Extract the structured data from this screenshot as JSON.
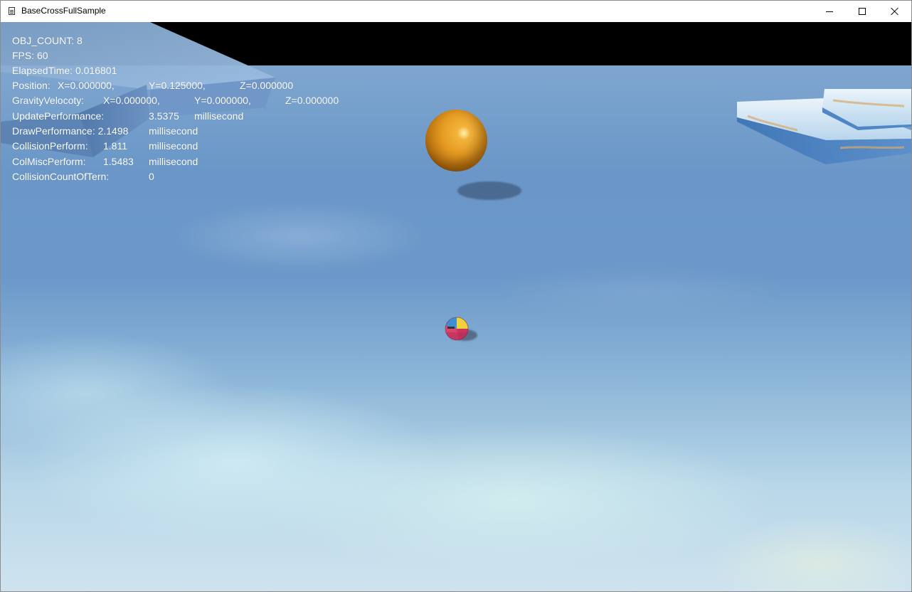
{
  "window": {
    "title": "BaseCrossFullSample",
    "icons": [
      "document-app-icon",
      "minimize-icon",
      "maximize-icon",
      "close-icon"
    ]
  },
  "hud": {
    "obj_count": "OBJ_COUNT: 8",
    "fps": "FPS: 60",
    "elapsed": "ElapsedTime: 0.016801",
    "position": {
      "label": "Position:",
      "x": "X=0.000000,",
      "y": "Y=0.125000,",
      "z": "Z=0.000000"
    },
    "gravity": {
      "label": "GravityVelocoty:",
      "x": "X=0.000000,",
      "y": "Y=0.000000,",
      "z": "Z=0.000000"
    },
    "update": {
      "label": "UpdatePerformance:",
      "value": "3.5375",
      "unit": "millisecond"
    },
    "draw": {
      "label": "DrawPerformance: 2.1498",
      "unit": "millisecond"
    },
    "collision": {
      "label": "CollisionPerform:",
      "value": "1.811",
      "unit": "millisecond"
    },
    "colmisc": {
      "label": "ColMiscPerform:",
      "value": "1.5483",
      "unit": "millisecond"
    },
    "collision_count": {
      "label": "CollisionCountOfTern:",
      "value": "0"
    }
  },
  "colors": {
    "sky_blue": "#6b98c9",
    "ball_orange": "#e69b22"
  }
}
